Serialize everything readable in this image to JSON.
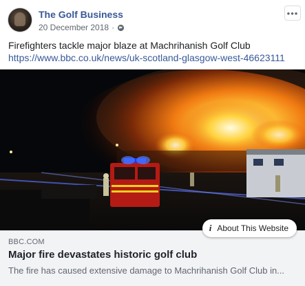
{
  "header": {
    "page_name": "The Golf Business",
    "date": "20 December 2018",
    "separator": "·",
    "privacy_icon": "globe-icon",
    "more_icon": "more-options-icon",
    "more_label": "•••"
  },
  "post": {
    "text": "Firefighters tackle major blaze at Machrihanish Golf Club",
    "link": "https://www.bbc.co.uk/news/uk-scotland-glasgow-west-46623111"
  },
  "preview": {
    "image_alt": "Fire engine in front of burning golf clubhouse at night",
    "about_label": "About This Website",
    "about_icon": "info-icon",
    "domain": "BBC.COM",
    "headline": "Major fire devastates historic golf club",
    "description": "The fire has caused extensive damage to Machrihanish Golf Club in..."
  },
  "colors": {
    "link_blue": "#385898",
    "meta_gray": "#606770",
    "footer_bg": "#f2f3f5"
  }
}
